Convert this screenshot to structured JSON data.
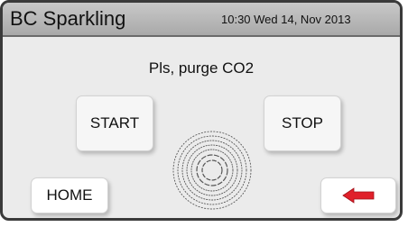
{
  "header": {
    "title": "BC Sparkling",
    "datetime": "10:30 Wed 14, Nov 2013"
  },
  "main": {
    "prompt": "Pls, purge CO2",
    "start_label": "START",
    "stop_label": "STOP",
    "home_label": "HOME",
    "back_icon": "left-arrow-icon",
    "status_icon": "concentric-rings-icon"
  },
  "colors": {
    "back_arrow": "#e0202a"
  }
}
